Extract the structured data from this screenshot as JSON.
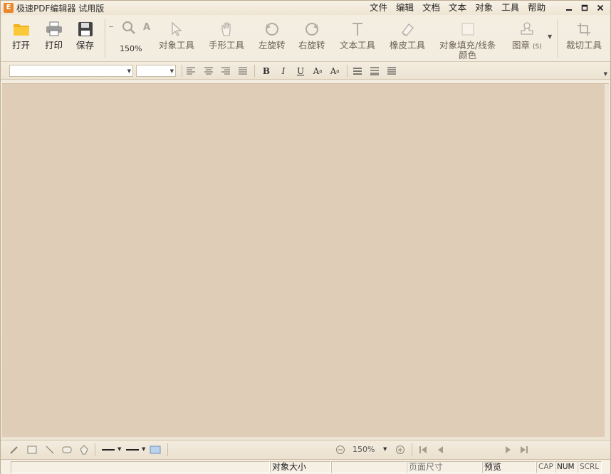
{
  "window": {
    "title": "极速PDF编辑器 试用版",
    "logo_text": "E"
  },
  "menu": [
    "文件",
    "编辑",
    "文档",
    "文本",
    "对象",
    "工具",
    "帮助"
  ],
  "window_controls": {
    "minimize": "▬",
    "maximize": "□",
    "close": "✕"
  },
  "toolbar": {
    "open": "打开",
    "print": "打印",
    "save": "保存",
    "zoom_level": "150%",
    "object_tool": "对象工具",
    "hand_tool": "手形工具",
    "rotate_left": "左旋转",
    "rotate_right": "右旋转",
    "text_tool": "文本工具",
    "eraser_tool": "橡皮工具",
    "fill_line_color_1": "对象填充/线条",
    "fill_line_color_2": "颜色",
    "stamp": "图章",
    "stamp_badge": "(S)",
    "crop_tool": "裁切工具"
  },
  "format": {
    "bold": "B",
    "italic": "I",
    "underline": "U",
    "superscript": "A",
    "subscript": "A"
  },
  "bottom": {
    "zoom_readout": "150%"
  },
  "status": {
    "cell0": "",
    "object_size": "对象大小",
    "blank": "",
    "page_size": "页面尺寸",
    "preview": "预览",
    "cap": "CAP",
    "num": "NUM",
    "scrl": "SCRL"
  },
  "colors": {
    "canvas": "#e0cdb7",
    "chrome": "#efe5d3",
    "accent": "#e9872a"
  }
}
